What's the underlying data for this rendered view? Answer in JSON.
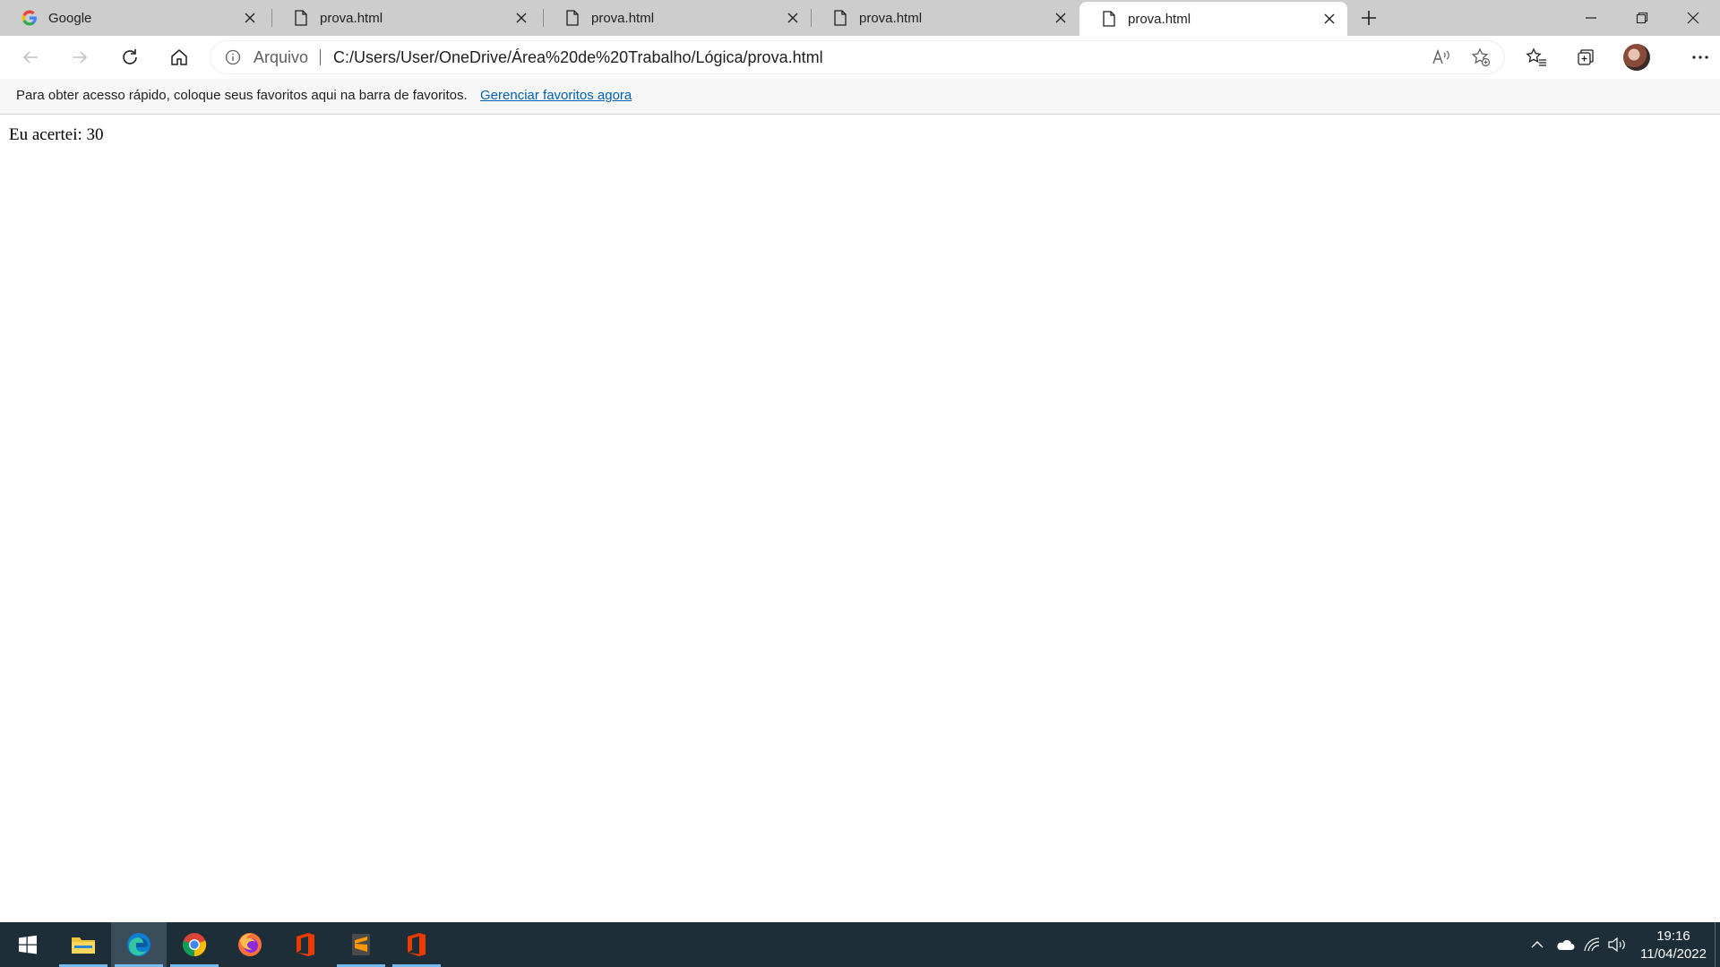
{
  "browser": {
    "tabs": [
      {
        "label": "Google",
        "icon": "google-icon",
        "active": false
      },
      {
        "label": "prova.html",
        "icon": "file-icon",
        "active": false
      },
      {
        "label": "prova.html",
        "icon": "file-icon",
        "active": false
      },
      {
        "label": "prova.html",
        "icon": "file-icon",
        "active": false
      },
      {
        "label": "prova.html",
        "icon": "file-icon",
        "active": true
      }
    ],
    "address_bar": {
      "scheme_label": "Arquivo",
      "url": "C:/Users/User/OneDrive/Área%20de%20Trabalho/Lógica/prova.html"
    },
    "favorites_bar": {
      "message": "Para obter acesso rápido, coloque seus favoritos aqui na barra de favoritos.",
      "link_label": "Gerenciar favoritos agora"
    }
  },
  "page": {
    "text": "Eu acertei: 30"
  },
  "taskbar": {
    "apps": [
      "start-icon",
      "file-explorer-icon",
      "edge-icon",
      "chrome-icon",
      "firefox-icon",
      "office-icon",
      "sublime-text-icon",
      "office-icon"
    ],
    "active_app": "edge-icon",
    "clock": {
      "time": "19:16",
      "date": "11/04/2022"
    }
  },
  "colors": {
    "tabstrip": "#cdcdcd",
    "link": "#0060b8",
    "taskbar": "#1e2e38",
    "taskbar_indicator": "#76b9ed"
  }
}
